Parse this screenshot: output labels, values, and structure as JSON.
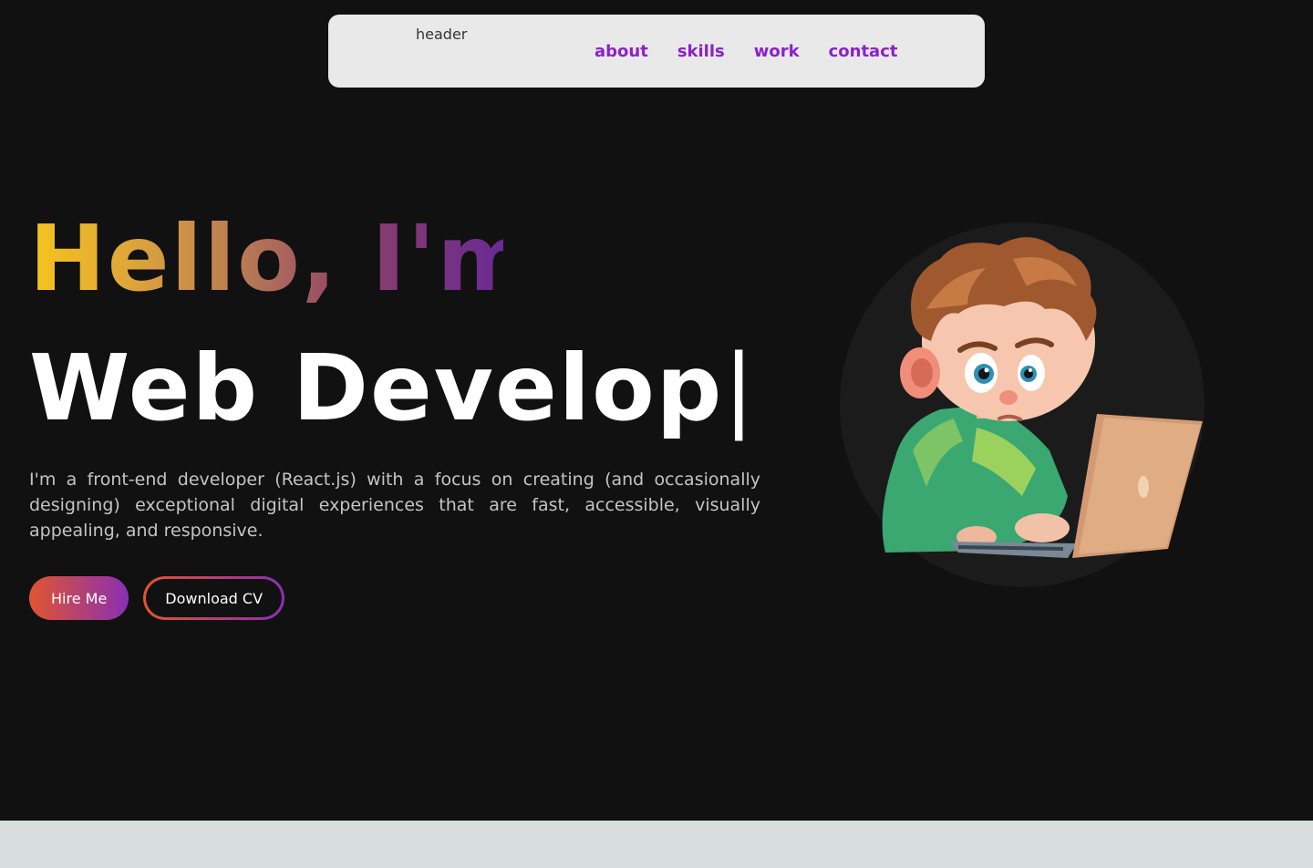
{
  "header": {
    "logo_alt": "header",
    "nav": [
      {
        "label": "about"
      },
      {
        "label": "skills"
      },
      {
        "label": "work"
      },
      {
        "label": "contact"
      }
    ]
  },
  "hero": {
    "greeting": "Hello, I'm",
    "role": "Web Develop",
    "cursor": "|",
    "bio": "I'm a front-end developer (React.js) with a focus on creating (and occasionally designing) exceptional digital experiences that are fast, accessible, visually appealing, and responsive.",
    "buttons": {
      "hire": "Hire Me",
      "cv": "Download CV"
    }
  },
  "colors": {
    "background": "#111111",
    "nav_bg": "#e9e9e9",
    "nav_link": "#8a22c9",
    "gradient_start": "#e0552e",
    "gradient_end": "#8a2fb3"
  },
  "icons": {
    "avatar": "boy-with-laptop-illustration",
    "logo": "broken-image-icon"
  }
}
